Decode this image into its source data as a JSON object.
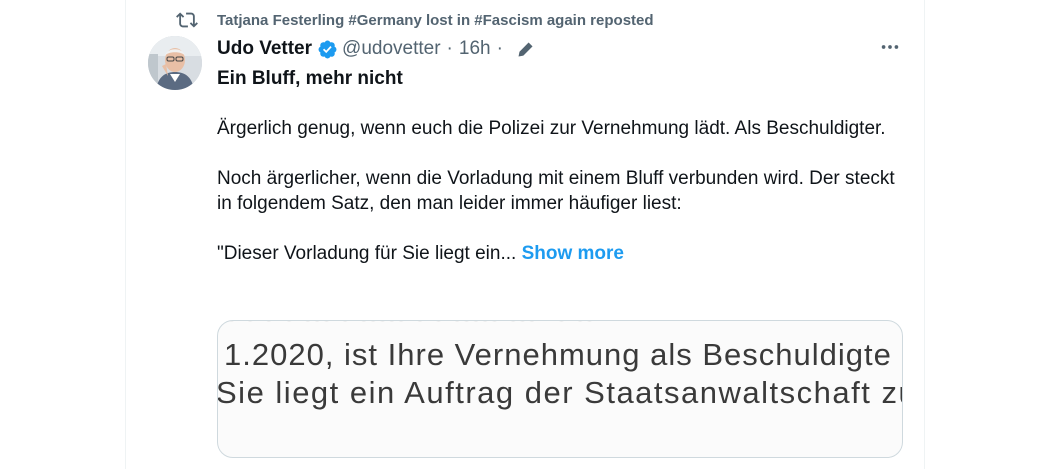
{
  "repost": {
    "text": "Tatjana Festerling #Germany lost in #Fascism again reposted",
    "icon": "repost-icon"
  },
  "author": {
    "display_name": "Udo Vetter",
    "verified_icon": "verified-badge-icon",
    "handle": "@udovetter",
    "separator": "·",
    "time": "16h",
    "separator2": "·",
    "edit_icon": "edit-pencil-icon"
  },
  "more_icon": "more-options-icon",
  "post": {
    "title": "Ein Bluff, mehr nicht",
    "paragraph1": "Ärgerlich genug, wenn euch die Polizei zur Vernehmung lädt. Als Beschuldigter.",
    "paragraph2": "Noch ärgerlicher, wenn die Vorladung mit einem Bluff verbunden wird. Der steckt in folgendem Satz, den man leider immer häufiger liest:",
    "paragraph3": "\"Dieser Vorladung für Sie liegt ein...",
    "show_more": "Show more"
  },
  "media": {
    "line1": "1.2020,  ist Ihre Vernehmung als Beschuldigte",
    "line2": "Sie liegt ein Auftrag der Staatsanwaltschaft zu"
  },
  "colors": {
    "link": "#1d9bf0",
    "verified": "#1d9bf0",
    "muted": "#536471",
    "text": "#0f1419",
    "border": "#cfd9de"
  }
}
